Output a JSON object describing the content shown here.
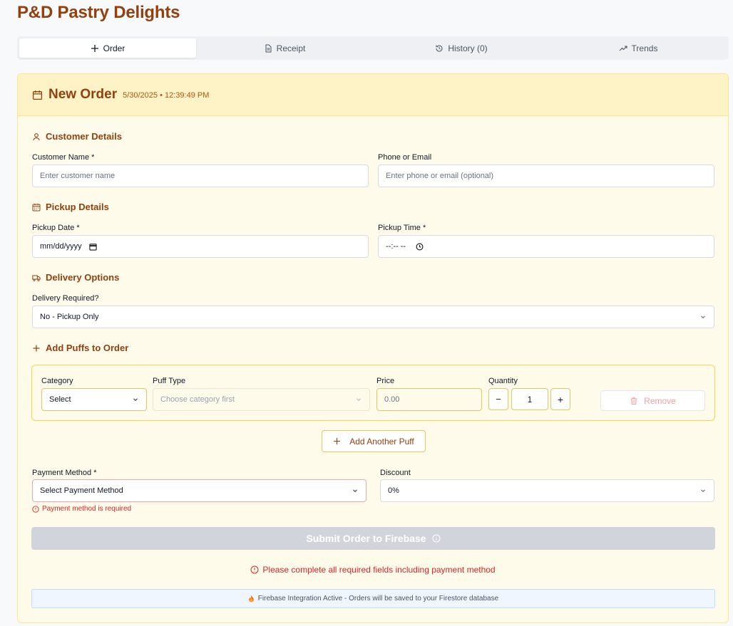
{
  "app": {
    "title": "P&D Pastry Delights"
  },
  "tabs": [
    {
      "label": "Order",
      "icon": "plus-icon",
      "active": true
    },
    {
      "label": "Receipt",
      "icon": "file-text-icon",
      "active": false
    },
    {
      "label": "History (0)",
      "icon": "history-icon",
      "active": false
    },
    {
      "label": "Trends",
      "icon": "trending-up-icon",
      "active": false
    }
  ],
  "order": {
    "title": "New Order",
    "timestamp": "5/30/2025 • 12:39:49 PM"
  },
  "customer": {
    "section_title": "Customer Details",
    "name_label": "Customer Name *",
    "name_placeholder": "Enter customer name",
    "contact_label": "Phone or Email",
    "contact_placeholder": "Enter phone or email (optional)"
  },
  "pickup": {
    "section_title": "Pickup Details",
    "date_label": "Pickup Date *",
    "date_value": "mm/dd/yyyy",
    "time_label": "Pickup Time *",
    "time_value": "--:-- --"
  },
  "delivery": {
    "section_title": "Delivery Options",
    "label": "Delivery Required?",
    "value": "No - Pickup Only"
  },
  "puffs": {
    "section_title": "Add Puffs to Order",
    "category_label": "Category",
    "category_value": "Select",
    "type_label": "Puff Type",
    "type_placeholder": "Choose category first",
    "price_label": "Price",
    "price_placeholder": "0.00",
    "quantity_label": "Quantity",
    "quantity_value": "1",
    "minus": "−",
    "plus": "+",
    "remove_label": "Remove",
    "add_another_label": "Add Another Puff"
  },
  "payment": {
    "label": "Payment Method *",
    "value": "Select Payment Method",
    "error": "Payment method is required",
    "discount_label": "Discount",
    "discount_value": "0%"
  },
  "submit": {
    "label": "Submit Order to Firebase",
    "warning": "Please complete all required fields including payment method"
  },
  "footer": {
    "info": "Firebase Integration Active - Orders will be saved to your Firestore database",
    "icon": "fire-icon"
  },
  "colors": {
    "brand": "#92400e",
    "card_bg": "#fffbeb",
    "header_bg": "#fef3c7",
    "error": "#dc2626"
  }
}
